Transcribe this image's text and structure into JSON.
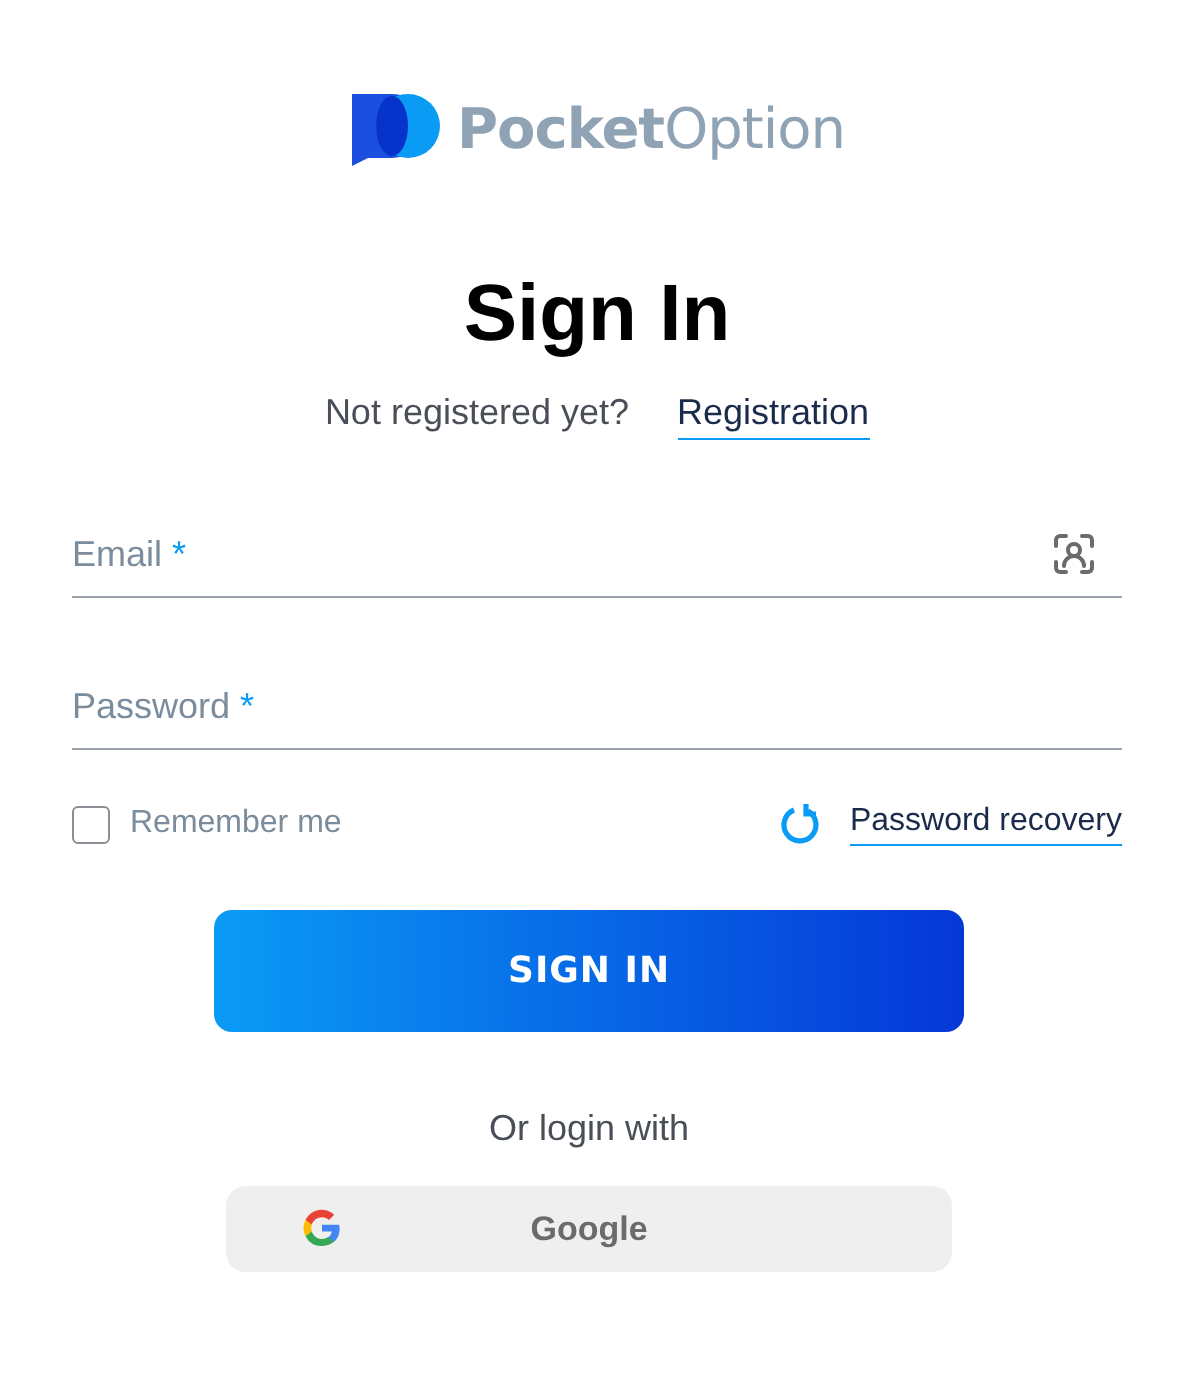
{
  "logo": {
    "text": "**Pocket**Option"
  },
  "title": "Sign In",
  "register_prompt": {
    "text": "Not registered yet?",
    "link": "Registration"
  },
  "fields": [
    {
      "kind": "email",
      "label": "Email",
      "required_mark": "*"
    },
    {
      "kind": "password",
      "label": "Password",
      "required_mark": "*"
    }
  ],
  "remember": {
    "label": "Remember me",
    "checked": false
  },
  "recovery_link": "Password recovery",
  "submit": "SIGN IN",
  "alt_login": {
    "prompt": "Or login with",
    "providers": [
      "Google"
    ]
  }
}
